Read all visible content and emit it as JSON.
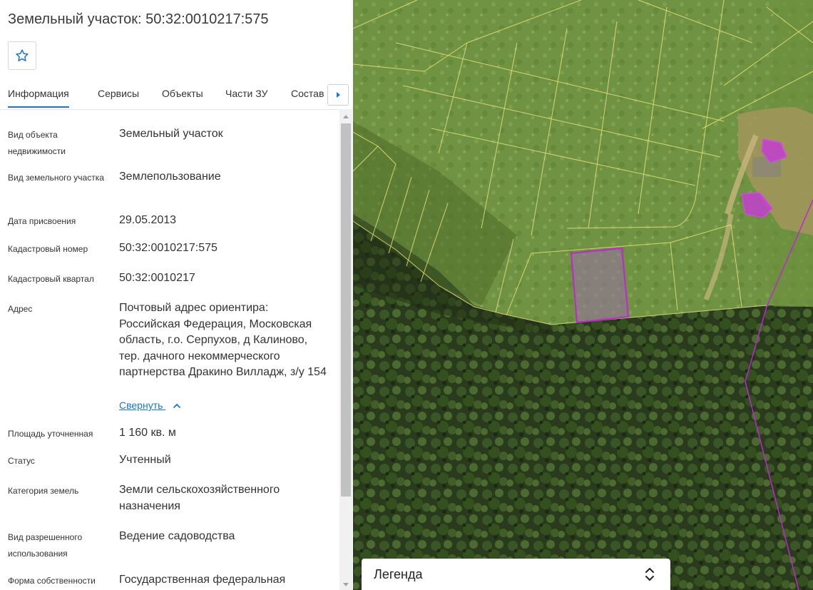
{
  "header": {
    "title": "Земельный участок: 50:32:0010217:575"
  },
  "tabs": [
    "Информация",
    "Сервисы",
    "Объекты",
    "Части ЗУ",
    "Состав"
  ],
  "info": {
    "object_type_label": "Вид объекта недвижимости",
    "object_type_value": "Земельный участок",
    "land_kind_label": "Вид земельного участка",
    "land_kind_value": "Землепользование",
    "assign_date_label": "Дата присвоения",
    "assign_date_value": "29.05.2013",
    "cadastral_number_label": "Кадастровый номер",
    "cadastral_number_value": "50:32:0010217:575",
    "cadastral_quarter_label": "Кадастровый квартал",
    "cadastral_quarter_value": "50:32:0010217",
    "address_label": "Адрес",
    "address_value": "Почтовый адрес ориентира: Российская Федерация, Московская область, г.о. Серпухов, д Калиново, тер. дачного некоммерческого партнерства Дракино Вилладж, з/у 154",
    "collapse_link": "Свернуть",
    "area_label": "Площадь уточненная",
    "area_value": "1 160 кв. м",
    "status_label": "Статус",
    "status_value": "Учтенный",
    "category_label": "Категория земель",
    "category_value": "Земли сельскохозяйственного назначения",
    "permitted_use_label": "Вид разрешенного использования",
    "permitted_use_value": "Ведение садоводства",
    "ownership_label": "Форма собственности",
    "ownership_value": "Государственная федеральная"
  },
  "legend": {
    "title": "Легенда"
  },
  "colors": {
    "accent": "#1976d2",
    "selected_parcel": "#c026d3",
    "parcel_lines": "#e8e27a"
  },
  "icons": {
    "favorite": "star-outline-icon",
    "tabs_next": "caret-right-icon",
    "collapse": "chevron-up-icon",
    "legend_toggle": "unfold-icon"
  }
}
